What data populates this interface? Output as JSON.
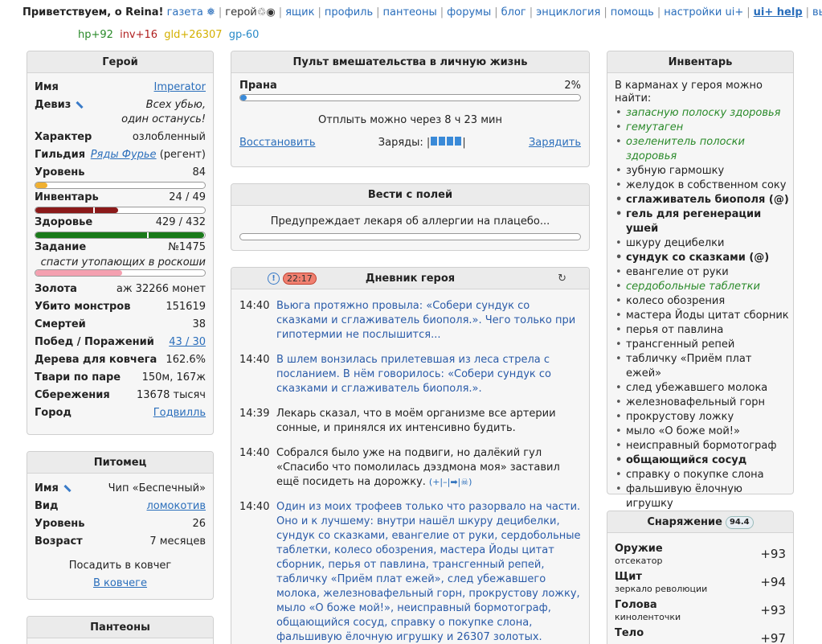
{
  "top": {
    "greeting": "Приветствуем, о Reina!",
    "links": [
      "газета ❅",
      "герой♲◉",
      "ящик",
      "профиль",
      "пантеоны",
      "форумы",
      "блог",
      "энциклогия",
      "помощь",
      "настройки ui+"
    ],
    "help": "ui+ help",
    "exit": "выход"
  },
  "stats": {
    "hp": "hp+92",
    "inv": "inv+16",
    "gld": "gld+26307",
    "gp": "gp-60"
  },
  "hero": {
    "title": "Герой",
    "name_k": "Имя",
    "name_v": "Imperator",
    "motto_k": "Девиз",
    "motto_v": "Всех убью, один останусь!",
    "char_k": "Характер",
    "char_v": "озлобленный",
    "guild_k": "Гильдия",
    "guild_v": "Ряды Фурье",
    "guild_rank": "(регент)",
    "level_k": "Уровень",
    "level_v": "84",
    "level_pct": 0.07,
    "inv_k": "Инвентарь",
    "inv_v": "24 / 49",
    "inv_pct": 0.49,
    "health_k": "Здоровье",
    "health_v": "429 / 432",
    "health_pct": 0.993,
    "quest_k": "Задание",
    "quest_v": "№1475",
    "quest_text": "спасти утопающих в роскоши",
    "quest_pct": 0.51,
    "gold_k": "Золота",
    "gold_v": "аж 32266 монет",
    "kills_k": "Убито монстров",
    "kills_v": "151619",
    "deaths_k": "Смертей",
    "deaths_v": "38",
    "wins_k": "Побед / Поражений",
    "wins_v": "43 / 30",
    "ark_k": "Дерева для ковчега",
    "ark_v": "162.6%",
    "pairs_k": "Твари по паре",
    "pairs_v": "150м, 167ж",
    "save_k": "Сбережения",
    "save_v": "13678 тысяч",
    "town_k": "Город",
    "town_v": "Годвилль"
  },
  "pet": {
    "title": "Питомец",
    "name_k": "Имя",
    "name_v": "Чип «Беспечный»",
    "kind_k": "Вид",
    "kind_v": "ломокотив",
    "lvl_k": "Уровень",
    "lvl_v": "26",
    "age_k": "Возраст",
    "age_v": "7 месяцев",
    "ark_text": "Посадить в ковчег",
    "ark_link": "В ковчеге"
  },
  "pantheons": {
    "title": "Пантеоны"
  },
  "control": {
    "title": "Пульт вмешательства в личную жизнь",
    "prana_k": "Прана",
    "prana_v": "2%",
    "prana_pct": 0.02,
    "cooldown": "Отплыть можно через 8 ч 23 мин",
    "restore": "Восстановить",
    "charges": "Заряды:",
    "charge": "Зарядить"
  },
  "news": {
    "title": "Вести с полей",
    "text": "Предупреждает лекаря об аллергии на плацебо..."
  },
  "diary": {
    "title": "Дневник героя",
    "timer": "22:17",
    "entries": [
      {
        "t": "14:40",
        "m": "Вьюга протяжно провыла: «Собери сундук со сказками и сглаживатель биополя.». Чего только при гипотермии не послышится..."
      },
      {
        "t": "14:40",
        "m": "В шлем вонзилась прилетевшая из леса стрела с посланием. В нём говорилось: «Собери сундук со сказками и сглаживатель биополя.»."
      },
      {
        "t": "14:39",
        "m": "Лекарь сказал, что в моём организме все артерии сонные, и принялся их интенсивно будить."
      },
      {
        "t": "14:40",
        "m": "Собрался было уже на подвиги, но далёкий гул «Спасибо что помолилась дэздмона моя» заставил ещё посидеть на дорожку.",
        "extra": "(+|–|➡|☠)"
      },
      {
        "t": "14:40",
        "m": "Один из моих трофеев только что разорвало на части. Оно и к лучшему: внутри нашёл шкуру децибелки, сундук со сказками, евангелие от руки, сердобольные таблетки, колесо обозрения, мастера Йоды цитат сборник, перья от павлина, трансгенный репей, табличку «Приём плат ежей», след убежавшего молока, железновафельный горн, прокрустову ложку, мыло «О боже мой!», неисправный бормотограф, общающийся сосуд, справку о покупке слона, фальшивую ёлочную игрушку и 26307 золотых."
      }
    ]
  },
  "inventory": {
    "title": "Инвентарь",
    "intro": "В карманах у героя можно найти:",
    "items": [
      {
        "n": "запасную полоску здоровья",
        "s": "g"
      },
      {
        "n": "гемутаген",
        "s": "g"
      },
      {
        "n": "озеленитель полоски здоровья",
        "s": "g"
      },
      {
        "n": "зубную гармошку",
        "s": ""
      },
      {
        "n": "желудок в собственном соку",
        "s": ""
      },
      {
        "n": "сглаживатель биополя (@)",
        "s": "b"
      },
      {
        "n": "гель для регенерации ушей",
        "s": "b"
      },
      {
        "n": "шкуру децибелки",
        "s": ""
      },
      {
        "n": "сундук со сказками (@)",
        "s": "b"
      },
      {
        "n": "евангелие от руки",
        "s": ""
      },
      {
        "n": "сердобольные таблетки",
        "s": "g"
      },
      {
        "n": "колесо обозрения",
        "s": ""
      },
      {
        "n": "мастера Йоды цитат сборник",
        "s": ""
      },
      {
        "n": "перья от павлина",
        "s": ""
      },
      {
        "n": "трансгенный репей",
        "s": ""
      },
      {
        "n": "табличку «Приём плат ежей»",
        "s": ""
      },
      {
        "n": "след убежавшего молока",
        "s": ""
      },
      {
        "n": "железновафельный горн",
        "s": ""
      },
      {
        "n": "прокрустову ложку",
        "s": ""
      },
      {
        "n": "мыло «О боже мой!»",
        "s": ""
      },
      {
        "n": "неисправный бормотограф",
        "s": ""
      },
      {
        "n": "общающийся сосуд",
        "s": "b"
      },
      {
        "n": "справку о покупке слона",
        "s": ""
      },
      {
        "n": "фальшивую ёлочную игрушку",
        "s": ""
      }
    ]
  },
  "equipment": {
    "title": "Снаряжение",
    "badge": "94.4",
    "items": [
      {
        "slot": "Оружие",
        "name": "отсекатор",
        "val": "+93"
      },
      {
        "slot": "Щит",
        "name": "зеркало революции",
        "val": "+94"
      },
      {
        "slot": "Голова",
        "name": "киноленточки",
        "val": "+93"
      },
      {
        "slot": "Тело",
        "name": "",
        "val": "+97"
      }
    ]
  }
}
